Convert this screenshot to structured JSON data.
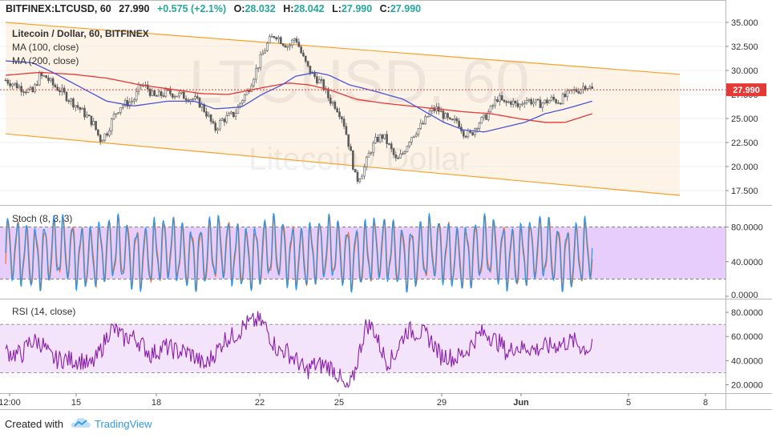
{
  "header": {
    "symbol": "BITFINEX:LTCUSD, 60",
    "last": "27.990",
    "change": "+0.575 (+2.1%)",
    "open_label": "O:",
    "open": "28.032",
    "high_label": "H:",
    "high": "28.042",
    "low_label": "L:",
    "low": "27.990",
    "close_label": "C:",
    "close": "27.990"
  },
  "legend": {
    "title": "Litecoin / Dollar, 60, BITFINEX",
    "ma100": "MA (100, close)",
    "ma200": "MA (200, close)"
  },
  "watermark": {
    "big": "LTCUSD, 60",
    "small": "Litecoin / Dollar"
  },
  "price_axis": {
    "ticks": [
      "35.000",
      "32.500",
      "30.000",
      "27.500",
      "25.000",
      "22.500",
      "20.000",
      "17.500"
    ],
    "current_price": "27.990"
  },
  "stoch": {
    "label": "Stoch (8, 3, 3)",
    "ticks": [
      "80.0000",
      "40.0000",
      "0.0000"
    ]
  },
  "rsi": {
    "label": "RSI (14, close)",
    "ticks": [
      "80.0000",
      "60.0000",
      "40.0000",
      "20.0000"
    ]
  },
  "time_axis": {
    "labels": [
      "12:00",
      "15",
      "18",
      "22",
      "25",
      "29",
      "Jun",
      "5",
      "8"
    ]
  },
  "colors": {
    "channel": "#f7a12b",
    "channel_fill": "#fdf3e7",
    "ma100": "#4a55d6",
    "ma200": "#e53935",
    "candle_up": "#5a5a5a",
    "candle_down": "#5a5a5a",
    "stoch_k": "#2196f3",
    "stoch_d": "#ff6b1a",
    "stoch_band": "#e7cdfb",
    "rsi_line": "#8b1fa9",
    "rsi_band": "#f3e3fb",
    "price_label_bg": "#e53935"
  },
  "footer": {
    "created": "Created with",
    "brand": "TradingView",
    "logo_icon": "tradingview-cloud-icon"
  },
  "chart_data": {
    "type": "candlestick",
    "y_range": [
      16.5,
      35.5
    ],
    "channel": {
      "upper": [
        [
          0,
          35.0
        ],
        [
          100,
          29.6
        ]
      ],
      "lower": [
        [
          0,
          23.4
        ],
        [
          100,
          17.0
        ]
      ]
    },
    "close_path": [
      [
        0,
        29.0
      ],
      [
        2,
        28.3
      ],
      [
        4,
        27.7
      ],
      [
        5,
        29.4
      ],
      [
        6,
        29.3
      ],
      [
        7,
        28.5
      ],
      [
        8,
        28.0
      ],
      [
        9,
        27.3
      ],
      [
        11,
        26.0
      ],
      [
        13,
        24.5
      ],
      [
        14,
        22.8
      ],
      [
        15,
        23.5
      ],
      [
        16,
        25.2
      ],
      [
        17,
        26.3
      ],
      [
        19,
        26.9
      ],
      [
        20,
        28.5
      ],
      [
        21,
        28.2
      ],
      [
        22,
        27.2
      ],
      [
        24,
        27.7
      ],
      [
        26,
        27.4
      ],
      [
        28,
        27.0
      ],
      [
        29,
        26.4
      ],
      [
        30,
        25.3
      ],
      [
        31,
        23.8
      ],
      [
        32,
        24.8
      ],
      [
        34,
        25.5
      ],
      [
        35,
        26.9
      ],
      [
        36,
        28.0
      ],
      [
        37,
        29.8
      ],
      [
        38,
        31.5
      ],
      [
        39,
        33.0
      ],
      [
        40,
        33.8
      ],
      [
        41,
        33.0
      ],
      [
        42,
        32.5
      ],
      [
        43,
        33.5
      ],
      [
        44,
        31.5
      ],
      [
        45,
        30.0
      ],
      [
        47,
        28.5
      ],
      [
        48,
        27.0
      ],
      [
        49,
        26.3
      ],
      [
        50,
        25.0
      ],
      [
        51,
        22.0
      ],
      [
        52,
        18.5
      ],
      [
        53,
        19.5
      ],
      [
        54,
        21.5
      ],
      [
        55,
        22.8
      ],
      [
        56,
        23.2
      ],
      [
        57,
        22.0
      ],
      [
        58,
        20.5
      ],
      [
        59,
        21.5
      ],
      [
        60,
        23.0
      ],
      [
        61,
        23.8
      ],
      [
        62,
        24.5
      ],
      [
        63,
        25.8
      ],
      [
        64,
        26.0
      ],
      [
        65,
        25.3
      ],
      [
        66,
        24.5
      ],
      [
        67,
        24.8
      ],
      [
        68,
        23.5
      ],
      [
        69,
        23.3
      ],
      [
        70,
        24.5
      ],
      [
        71,
        25.0
      ],
      [
        72,
        26.0
      ],
      [
        73,
        27.2
      ],
      [
        74,
        26.5
      ],
      [
        75,
        26.8
      ],
      [
        76,
        26.2
      ],
      [
        77,
        27.0
      ],
      [
        78,
        26.8
      ],
      [
        79,
        26.5
      ],
      [
        80,
        26.7
      ],
      [
        81,
        27.0
      ],
      [
        82,
        26.8
      ],
      [
        83,
        27.3
      ],
      [
        84,
        27.8
      ],
      [
        85,
        28.0
      ],
      [
        86,
        28.5
      ],
      [
        87,
        27.99
      ]
    ],
    "ma100_path": [
      [
        0,
        31.0
      ],
      [
        4,
        30.8
      ],
      [
        7,
        29.8
      ],
      [
        11,
        28.3
      ],
      [
        15,
        26.8
      ],
      [
        19,
        26.3
      ],
      [
        24,
        26.8
      ],
      [
        28,
        26.8
      ],
      [
        31,
        26.0
      ],
      [
        35,
        26.2
      ],
      [
        38,
        27.5
      ],
      [
        41,
        28.5
      ],
      [
        43,
        29.4
      ],
      [
        46,
        29.8
      ],
      [
        48,
        29.5
      ],
      [
        51,
        28.5
      ],
      [
        55,
        27.8
      ],
      [
        59,
        27.0
      ],
      [
        62,
        25.8
      ],
      [
        65,
        24.6
      ],
      [
        68,
        23.8
      ],
      [
        71,
        23.6
      ],
      [
        74,
        24.1
      ],
      [
        77,
        24.6
      ],
      [
        80,
        25.5
      ],
      [
        83,
        26.0
      ],
      [
        85,
        26.4
      ],
      [
        87,
        26.8
      ]
    ],
    "ma200_path": [
      [
        0,
        29.5
      ],
      [
        5,
        29.8
      ],
      [
        10,
        29.6
      ],
      [
        15,
        29.2
      ],
      [
        20,
        28.5
      ],
      [
        25,
        28.0
      ],
      [
        29,
        27.6
      ],
      [
        33,
        27.5
      ],
      [
        38,
        28.2
      ],
      [
        42,
        28.7
      ],
      [
        45,
        28.5
      ],
      [
        48,
        28.0
      ],
      [
        52,
        27.0
      ],
      [
        56,
        26.6
      ],
      [
        60,
        26.3
      ],
      [
        64,
        26.0
      ],
      [
        68,
        25.7
      ],
      [
        72,
        25.5
      ],
      [
        76,
        25.0
      ],
      [
        80,
        24.6
      ],
      [
        83,
        24.6
      ],
      [
        87,
        25.5
      ]
    ],
    "stoch": {
      "y_range": [
        0,
        100
      ],
      "overbought": 80,
      "oversold": 20
    },
    "rsi": {
      "y_range": [
        15,
        88
      ],
      "upper": 70,
      "lower": 30,
      "last": 58
    }
  }
}
